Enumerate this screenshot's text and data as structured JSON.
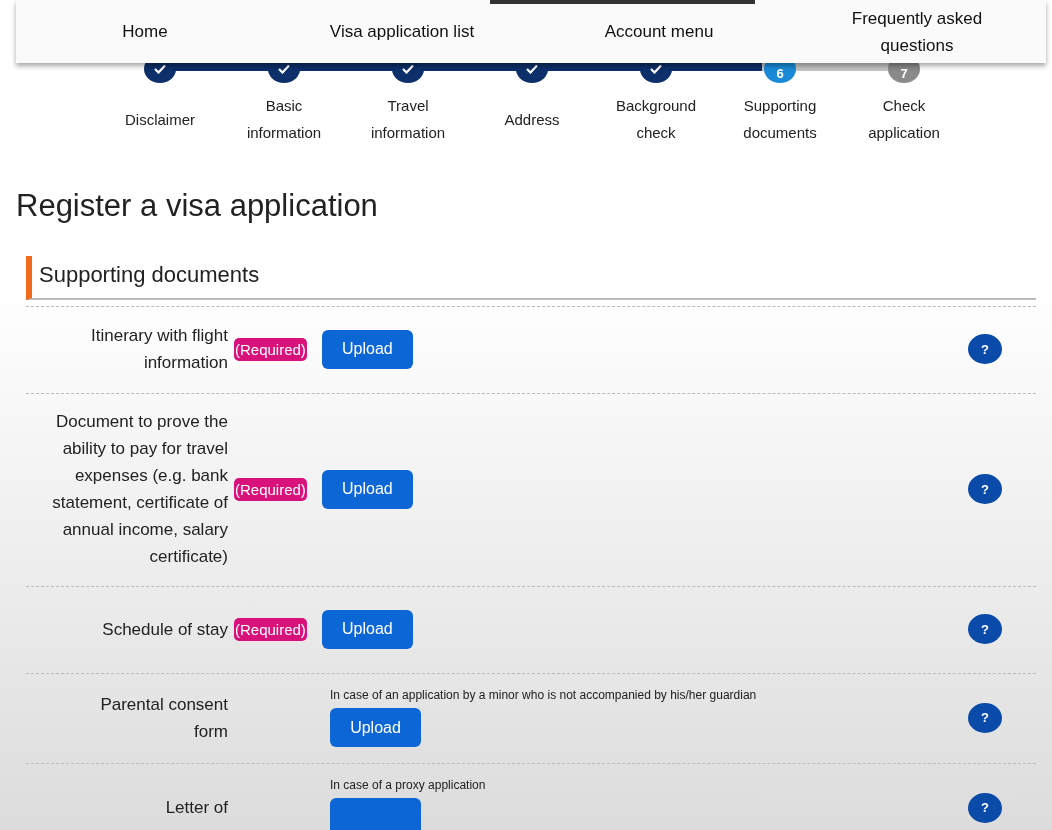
{
  "nav": {
    "items": [
      "Home",
      "Visa application list",
      "Account menu",
      "Frequently asked questions"
    ]
  },
  "steps": [
    {
      "label": "Disclaimer",
      "done": true,
      "current": false
    },
    {
      "label": "Basic information",
      "done": true,
      "current": false
    },
    {
      "label": "Travel information",
      "done": true,
      "current": false
    },
    {
      "label": "Address",
      "done": true,
      "current": false
    },
    {
      "label": "Background check",
      "done": true,
      "current": false
    },
    {
      "label": "Supporting documents",
      "done": false,
      "current": true,
      "number": "6"
    },
    {
      "label": "Check application",
      "done": false,
      "current": false,
      "number": "7"
    }
  ],
  "page_title": "Register a visa application",
  "section_title": "Supporting documents",
  "documents": [
    {
      "label": "Itinerary with flight information",
      "required": true,
      "badge": "(Required)",
      "upload": "Upload",
      "help": "?"
    },
    {
      "label": "Document to prove the ability to pay for travel expenses (e.g. bank statement, certificate of annual income, salary certificate)",
      "required": true,
      "badge": "(Required)",
      "upload": "Upload",
      "help": "?"
    },
    {
      "label": "Schedule of stay",
      "required": true,
      "badge": "(Required)",
      "upload": "Upload",
      "help": "?"
    },
    {
      "label": "Parental consent form",
      "required": false,
      "note": "In case of an application by a minor who is not accompanied by his/her guardian",
      "upload": "Upload",
      "help": "?"
    },
    {
      "label": "Letter of",
      "required": false,
      "note": "In case of a proxy application",
      "help": "?"
    }
  ]
}
